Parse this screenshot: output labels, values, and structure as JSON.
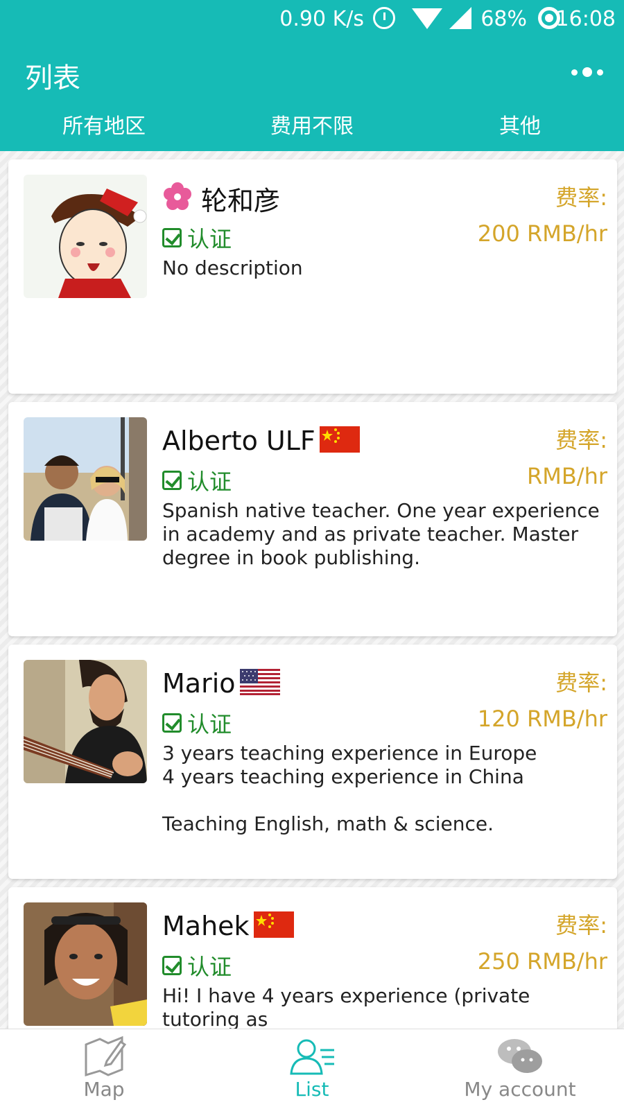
{
  "status_bar": {
    "net_speed": "0.90 K/s",
    "battery": "68%",
    "time": "16:08"
  },
  "header": {
    "title": "列表",
    "more_icon": "more-dots-icon"
  },
  "filters": [
    {
      "label": "所有地区"
    },
    {
      "label": "费用不限"
    },
    {
      "label": "其他"
    }
  ],
  "teachers": [
    {
      "name": "轮和彦",
      "flag": "japan-flower-flag",
      "rate_label": "费率:",
      "rate": "200 RMB/hr",
      "verified": "认证",
      "description": "No description"
    },
    {
      "name": "Alberto ULF",
      "flag": "china-flag",
      "rate_label": "费率:",
      "rate": "RMB/hr",
      "verified": "认证",
      "description": "Spanish native teacher. One year experience in academy and as private teacher. Master degree in book publishing."
    },
    {
      "name": "Mario",
      "flag": "usa-flag",
      "rate_label": "费率:",
      "rate": "120 RMB/hr",
      "verified": "认证",
      "description": "3 years teaching experience in Europe\n4 years teaching experience in China\n\nTeaching English, math & science."
    },
    {
      "name": "Mahek",
      "flag": "china-flag",
      "rate_label": "费率:",
      "rate": "250 RMB/hr",
      "verified": "认证",
      "description": "Hi! I have 4 years experience (private tutoring as"
    }
  ],
  "tabbar": {
    "items": [
      {
        "label": "Map",
        "icon": "map-icon"
      },
      {
        "label": "List",
        "icon": "list-user-icon",
        "active": true
      },
      {
        "label": "My account",
        "icon": "wechat-icon"
      }
    ]
  },
  "colors": {
    "header": "#16bbb6",
    "rate": "#d4a52a",
    "verified": "#218c2b"
  }
}
